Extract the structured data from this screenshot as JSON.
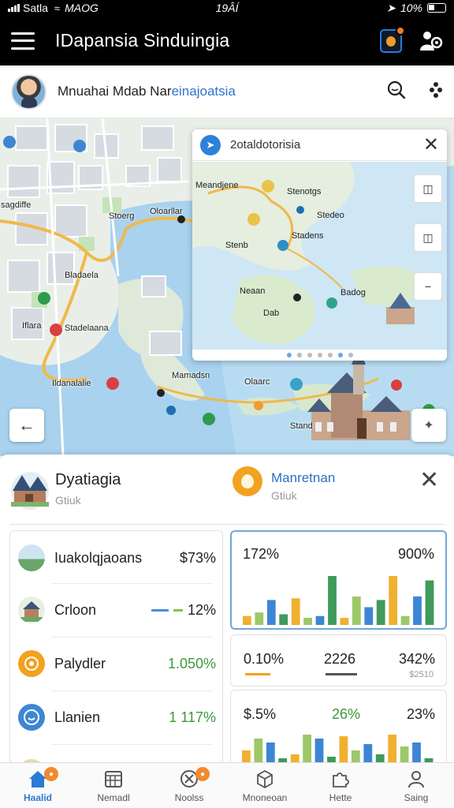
{
  "status_bar": {
    "carrier": "Satla",
    "network": "MAOG",
    "time": "19ÂÍ",
    "battery": "10%"
  },
  "app_bar": {
    "title": "IDapansia Sinduingia"
  },
  "profile": {
    "name_main": "Mnuahai Mdab Nar",
    "name_accent": "einajoatsia"
  },
  "map": {
    "labels": [
      "Isagdiffe",
      "Stoerg",
      "Oloarllar",
      "Bladaela",
      "Iflara",
      "Stadelaana",
      "Ildanalalie",
      "Mamadsn",
      "Olaarc",
      "Stand"
    ],
    "card": {
      "title": "2otaldotorisia",
      "labels": [
        "Meandjene",
        "Stenotgs",
        "Stedeo",
        "Stadens",
        "Stenb",
        "Neaan",
        "Dab",
        "Badog"
      ],
      "pages": 7,
      "current_page": 6
    }
  },
  "place": {
    "name": "Dyatiagia",
    "subtitle": "Gtiuk"
  },
  "manager": {
    "name": "Manretnan",
    "subtitle": "Gtiuk"
  },
  "list": [
    {
      "label": "Iuakolqjaoans",
      "value": "$73%",
      "icon": "landscape-icon",
      "color": ""
    },
    {
      "label": "Crloon",
      "value": "12%",
      "icon": "house-icon",
      "color": ""
    },
    {
      "label": "Palydler",
      "value": "1.050%",
      "icon": "orange-circle-icon",
      "color": "green"
    },
    {
      "label": "Llanien",
      "value": "1 117%",
      "icon": "blue-circle-icon",
      "color": "green"
    }
  ],
  "stats": {
    "card1": {
      "left": "172%",
      "right": "900%"
    },
    "card2": {
      "a": "0.10%",
      "b": "2226",
      "c": "342%",
      "c_sub": "$2510"
    },
    "card3": {
      "a": "$.5%",
      "b": "26%",
      "c": "23%"
    }
  },
  "chart_data": [
    {
      "type": "bar",
      "series": [
        {
          "values": [
            10,
            14,
            28,
            12,
            30,
            8,
            10,
            55,
            8,
            32,
            20,
            28,
            55,
            10,
            32,
            50
          ]
        }
      ]
    },
    {
      "type": "bar",
      "series": [
        {
          "values": [
            20,
            35,
            30,
            10,
            15,
            40,
            35,
            12,
            38,
            20,
            28,
            15,
            40,
            25,
            30,
            10
          ]
        }
      ]
    }
  ],
  "nav": [
    {
      "label": "Haalid",
      "icon": "home-icon",
      "badge": true
    },
    {
      "label": "Nemadl",
      "icon": "calendar-icon",
      "badge": false
    },
    {
      "label": "Noolss",
      "icon": "tools-icon",
      "badge": true
    },
    {
      "label": "Mnoneoan",
      "icon": "box-icon",
      "badge": false
    },
    {
      "label": "Hette",
      "icon": "puzzle-icon",
      "badge": false
    },
    {
      "label": "Saing",
      "icon": "profile-icon",
      "badge": false
    }
  ],
  "colors": {
    "accent": "#2c7ad3",
    "orange": "#f2a21f",
    "green": "#3a9a3a",
    "bar_green": "#3f9a5b",
    "bar_blue": "#3d86d4",
    "bar_orange": "#f0b030",
    "bar_lightgreen": "#9cc868"
  }
}
